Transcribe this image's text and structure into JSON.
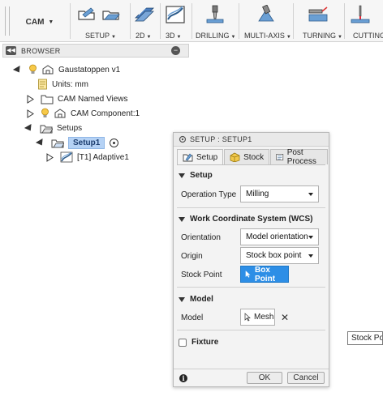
{
  "toolbar": {
    "workspace": "CAM",
    "groups": [
      {
        "label": "SETUP",
        "icon": "setup-icon"
      },
      {
        "label": "2D",
        "icon": "2d-milling-icon"
      },
      {
        "label": "3D",
        "icon": "3d-milling-icon"
      },
      {
        "label": "DRILLING",
        "icon": "drill-icon"
      },
      {
        "label": "MULTI-AXIS",
        "icon": "multi-axis-icon"
      },
      {
        "label": "TURNING",
        "icon": "turning-icon"
      },
      {
        "label": "CUTTING",
        "icon": "cutting-icon"
      }
    ]
  },
  "browser": {
    "title": "BROWSER",
    "root": "Gaustatoppen v1",
    "units": "Units: mm",
    "named_views": "CAM Named Views",
    "component": "CAM Component:1",
    "setups": "Setups",
    "setup1": "Setup1",
    "operation": "[T1] Adaptive1"
  },
  "dialog": {
    "title": "SETUP : SETUP1",
    "tabs": [
      "Setup",
      "Stock",
      "Post Process"
    ],
    "setup_section": "Setup",
    "operation_type_label": "Operation Type",
    "operation_type_value": "Milling",
    "wcs_section": "Work Coordinate System (WCS)",
    "orientation_label": "Orientation",
    "orientation_value": "Model orientation",
    "origin_label": "Origin",
    "origin_value": "Stock box point",
    "stock_point_label": "Stock Point",
    "stock_point_button": "Box Point",
    "model_section": "Model",
    "model_label": "Model",
    "model_button": "Mesh",
    "model_clear": "✕",
    "fixture_label": "Fixture",
    "info": "i",
    "ok": "OK",
    "cancel": "Cancel"
  },
  "tooltip": "Stock Point",
  "colors": {
    "accent": "#2d8ee6",
    "selection": "#b5d2f5"
  }
}
